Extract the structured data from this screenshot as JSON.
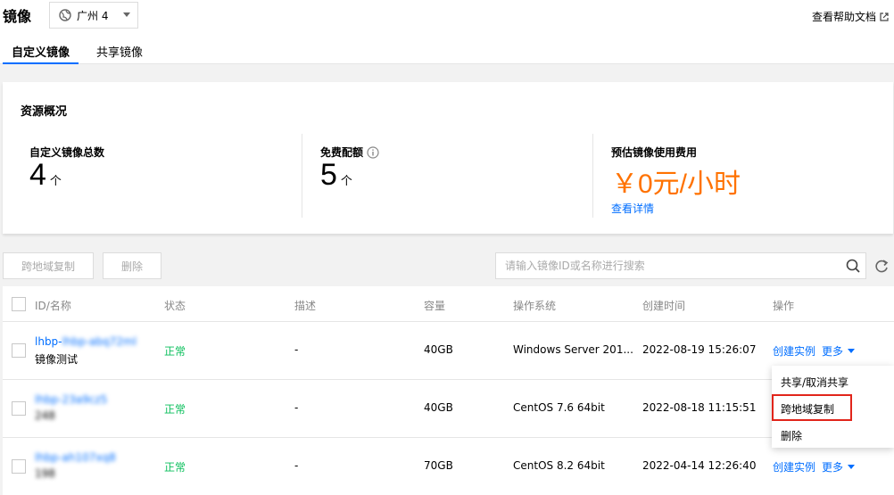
{
  "header": {
    "title": "镜像",
    "region": "广州 4",
    "help_link": "查看帮助文档"
  },
  "tabs": [
    {
      "label": "自定义镜像",
      "active": true
    },
    {
      "label": "共享镜像",
      "active": false
    }
  ],
  "overview": {
    "title": "资源概况",
    "stats": [
      {
        "label": "自定义镜像总数",
        "value": "4",
        "unit": "个"
      },
      {
        "label": "免费配额",
        "value": "5",
        "unit": "个"
      },
      {
        "label": "预估镜像使用费用",
        "value": "￥0元/小时",
        "link": "查看详情"
      }
    ]
  },
  "toolbar": {
    "copy_label": "跨地域复制",
    "delete_label": "删除",
    "search_placeholder": "请输入镜像ID或名称进行搜索"
  },
  "table": {
    "columns": [
      "ID/名称",
      "状态",
      "描述",
      "容量",
      "操作系统",
      "创建时间",
      "操作"
    ],
    "rows": [
      {
        "id": "lhbp-abq72ml",
        "name": "镜像测试",
        "status": "正常",
        "desc": "-",
        "size": "40GB",
        "os": "Windows Server 201...",
        "created": "2022-08-19 15:26:07",
        "action": "创建实例",
        "more": "更多"
      },
      {
        "id": "lhbp-23a9cz5",
        "name": "248",
        "status": "正常",
        "desc": "-",
        "size": "40GB",
        "os": "CentOS 7.6 64bit",
        "created": "2022-08-18 11:15:51",
        "action": "",
        "more": ""
      },
      {
        "id": "lhbp-ah107xq8",
        "name": "198",
        "status": "正常",
        "desc": "-",
        "size": "70GB",
        "os": "CentOS 8.2 64bit",
        "created": "2022-04-14 12:26:40",
        "action": "创建实例",
        "more": "更多"
      }
    ]
  },
  "dropdown": {
    "items": [
      "共享/取消共享",
      "跨地域复制",
      "删除"
    ]
  },
  "colors": {
    "link": "#006eff",
    "status_ok": "#0abf5b",
    "cost": "#ff7200",
    "highlight": "#e1251b"
  }
}
